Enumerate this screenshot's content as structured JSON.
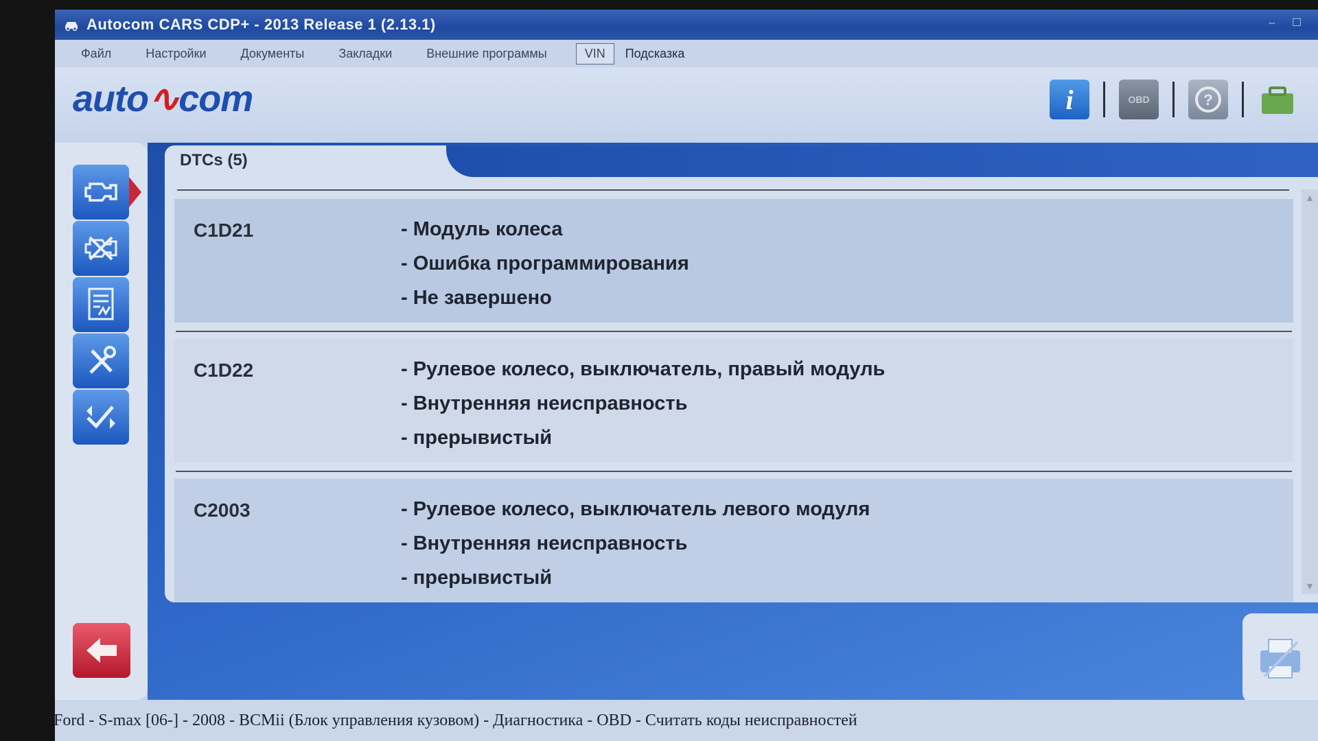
{
  "window": {
    "title": "Autocom CARS CDP+ - 2013 Release 1 (2.13.1)",
    "minimize": "–",
    "maximize": "☐"
  },
  "menu": {
    "items": [
      "Файл",
      "Настройки",
      "Документы",
      "Закладки",
      "Внешние программы"
    ],
    "vin": "VIN",
    "hint": "Подсказка"
  },
  "header": {
    "logo_left": "auto",
    "logo_right": "com",
    "info_label": "i",
    "obd_label": "OBD"
  },
  "tab": {
    "label": "DTCs (5)"
  },
  "dtcs": [
    {
      "code": "C1D21",
      "lines": [
        "- Модуль колеса",
        "- Ошибка программирования",
        "- Не завершено"
      ]
    },
    {
      "code": "C1D22",
      "lines": [
        "- Рулевое колесо, выключатель, правый модуль",
        "- Внутренняя неисправность",
        "- прерывистый"
      ]
    },
    {
      "code": "C2003",
      "lines": [
        "- Рулевое колесо, выключатель левого модуля",
        "- Внутренняя неисправность",
        "- прерывистый"
      ]
    }
  ],
  "status": {
    "text": "Ford - S-max [06-] - 2008 - BCMii (Блок управления кузовом) - Диагностика - OBD - Считать коды неисправностей"
  },
  "colors": {
    "accent": "#1f4fae",
    "logo_red": "#d11f1f",
    "back_button": "#c8283a"
  },
  "icons": {
    "engine": "engine-icon",
    "clear": "clear-codes-icon",
    "live_data": "live-data-icon",
    "tools": "tools-icon",
    "adjust": "adjust-icon",
    "back": "back-arrow-icon",
    "print": "print-icon"
  }
}
